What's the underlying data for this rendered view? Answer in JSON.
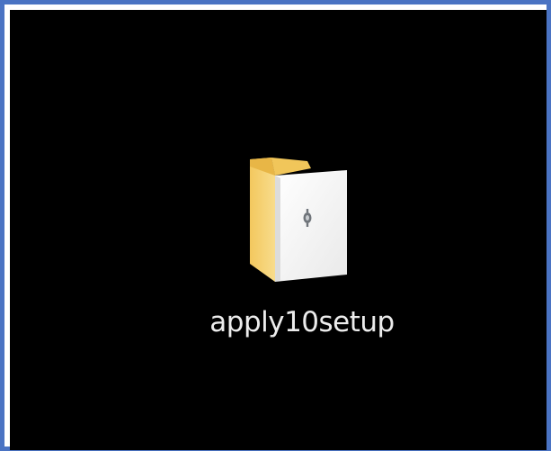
{
  "screen": {
    "frame_color": "#4a73c3",
    "background_color": "#000000"
  },
  "desktop_item": {
    "icon": "folder-icon",
    "icon_overlay": "document-gear-icon",
    "folder_color": "#f6d37a",
    "label": "apply10setup"
  }
}
